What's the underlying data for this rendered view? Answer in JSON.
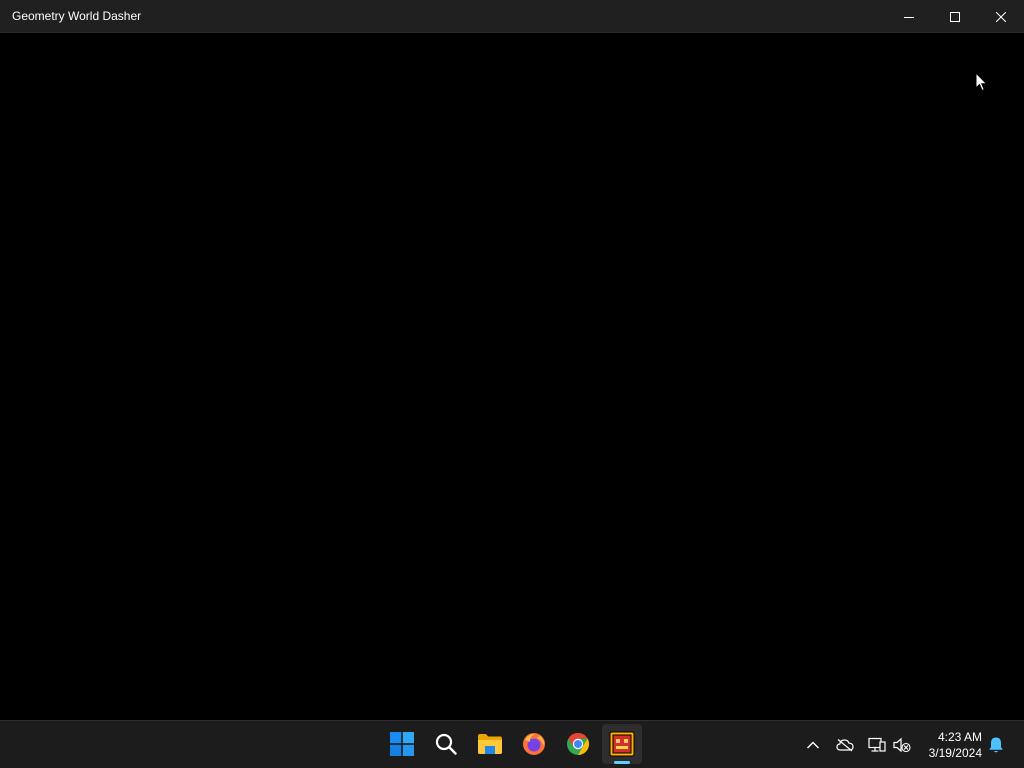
{
  "window": {
    "title": "Geometry World Dasher",
    "controls": {
      "minimize_icon": "minimize-icon",
      "maximize_icon": "maximize-icon",
      "close_icon": "close-icon"
    }
  },
  "taskbar": {
    "pinned": [
      {
        "name": "start",
        "icon": "windows-logo-icon"
      },
      {
        "name": "search",
        "icon": "search-icon"
      },
      {
        "name": "file-explorer",
        "icon": "folder-icon"
      },
      {
        "name": "firefox",
        "icon": "firefox-icon"
      },
      {
        "name": "chrome",
        "icon": "chrome-icon"
      },
      {
        "name": "geometry-dash",
        "icon": "geometry-dash-icon",
        "active": true
      }
    ],
    "tray": {
      "icons": [
        "chevron-up-icon",
        "cloud-offline-icon",
        "network-icon",
        "volume-muted-icon",
        "notification-bell-icon"
      ],
      "time": "4:23 AM",
      "date": "3/19/2024"
    },
    "colors": {
      "accent": "#60cdff",
      "background": "#1c1c1c"
    }
  }
}
